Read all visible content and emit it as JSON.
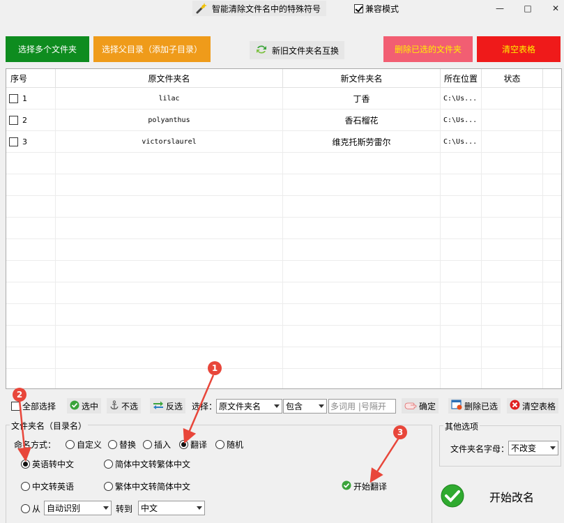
{
  "window": {
    "title": "智能清除文件名中的特殊符号",
    "compat_mode": "兼容模式",
    "minimize": "—",
    "maximize": "□",
    "close": "✕"
  },
  "top_buttons": {
    "select_multiple": "选择多个文件夹",
    "select_parent": "选择父目录（添加子目录）",
    "swap_names": "新旧文件夹名互换",
    "delete_selected": "删除已选的文件夹",
    "clear_table": "清空表格"
  },
  "colors": {
    "select_multiple_bg": "#0e8c1f",
    "select_parent_bg": "#ef9b1a",
    "delete_selected_bg": "#f25e72",
    "delete_selected_fg": "#fff000",
    "clear_table_bg": "#ef1a1a",
    "clear_table_fg": "#fff000",
    "badge": "#e8463a",
    "arrow": "#e8463a"
  },
  "table": {
    "columns": [
      "序号",
      "原文件夹名",
      "新文件夹名",
      "所在位置",
      "状态"
    ],
    "rows": [
      {
        "index": "1",
        "original": "lilac",
        "new": "丁香",
        "location": "C:\\Us...",
        "status": ""
      },
      {
        "index": "2",
        "original": "polyanthus",
        "new": "香石榴花",
        "location": "C:\\Us...",
        "status": ""
      },
      {
        "index": "3",
        "original": "victorslaurel",
        "new": "维克托斯劳雷尔",
        "location": "C:\\Us...",
        "status": ""
      }
    ]
  },
  "toolbar": {
    "select_all": "全部选择",
    "select": "选中",
    "deselect": "不选",
    "invert": "反选",
    "choose_label": "选择：",
    "choose_field": "原文件夹名",
    "match_mode": "包含",
    "keyword_placeholder": "多词用 |号隔开",
    "confirm": "确定",
    "delete_selected": "删除已选",
    "clear_table": "清空表格"
  },
  "folder_group": {
    "title": "文件夹名（目录名）",
    "naming_label": "命名方式：",
    "modes": [
      "自定义",
      "替换",
      "插入",
      "翻译",
      "随机"
    ],
    "selected_mode": "翻译",
    "options": {
      "en_to_zh": "英语转中文",
      "simp_to_trad": "简体中文转繁体中文",
      "zh_to_en": "中文转英语",
      "trad_to_simp": "繁体中文转简体中文",
      "from": "从",
      "from_lang": "自动识别",
      "to_label": "转到",
      "to_lang": "中文"
    },
    "selected_option": "英语转中文",
    "start_translate": "开始翻译"
  },
  "other_group": {
    "title": "其他选项",
    "case_label": "文件夹名字母：",
    "case_value": "不改变"
  },
  "start_rename": "开始改名",
  "badges": [
    "1",
    "2",
    "3"
  ]
}
